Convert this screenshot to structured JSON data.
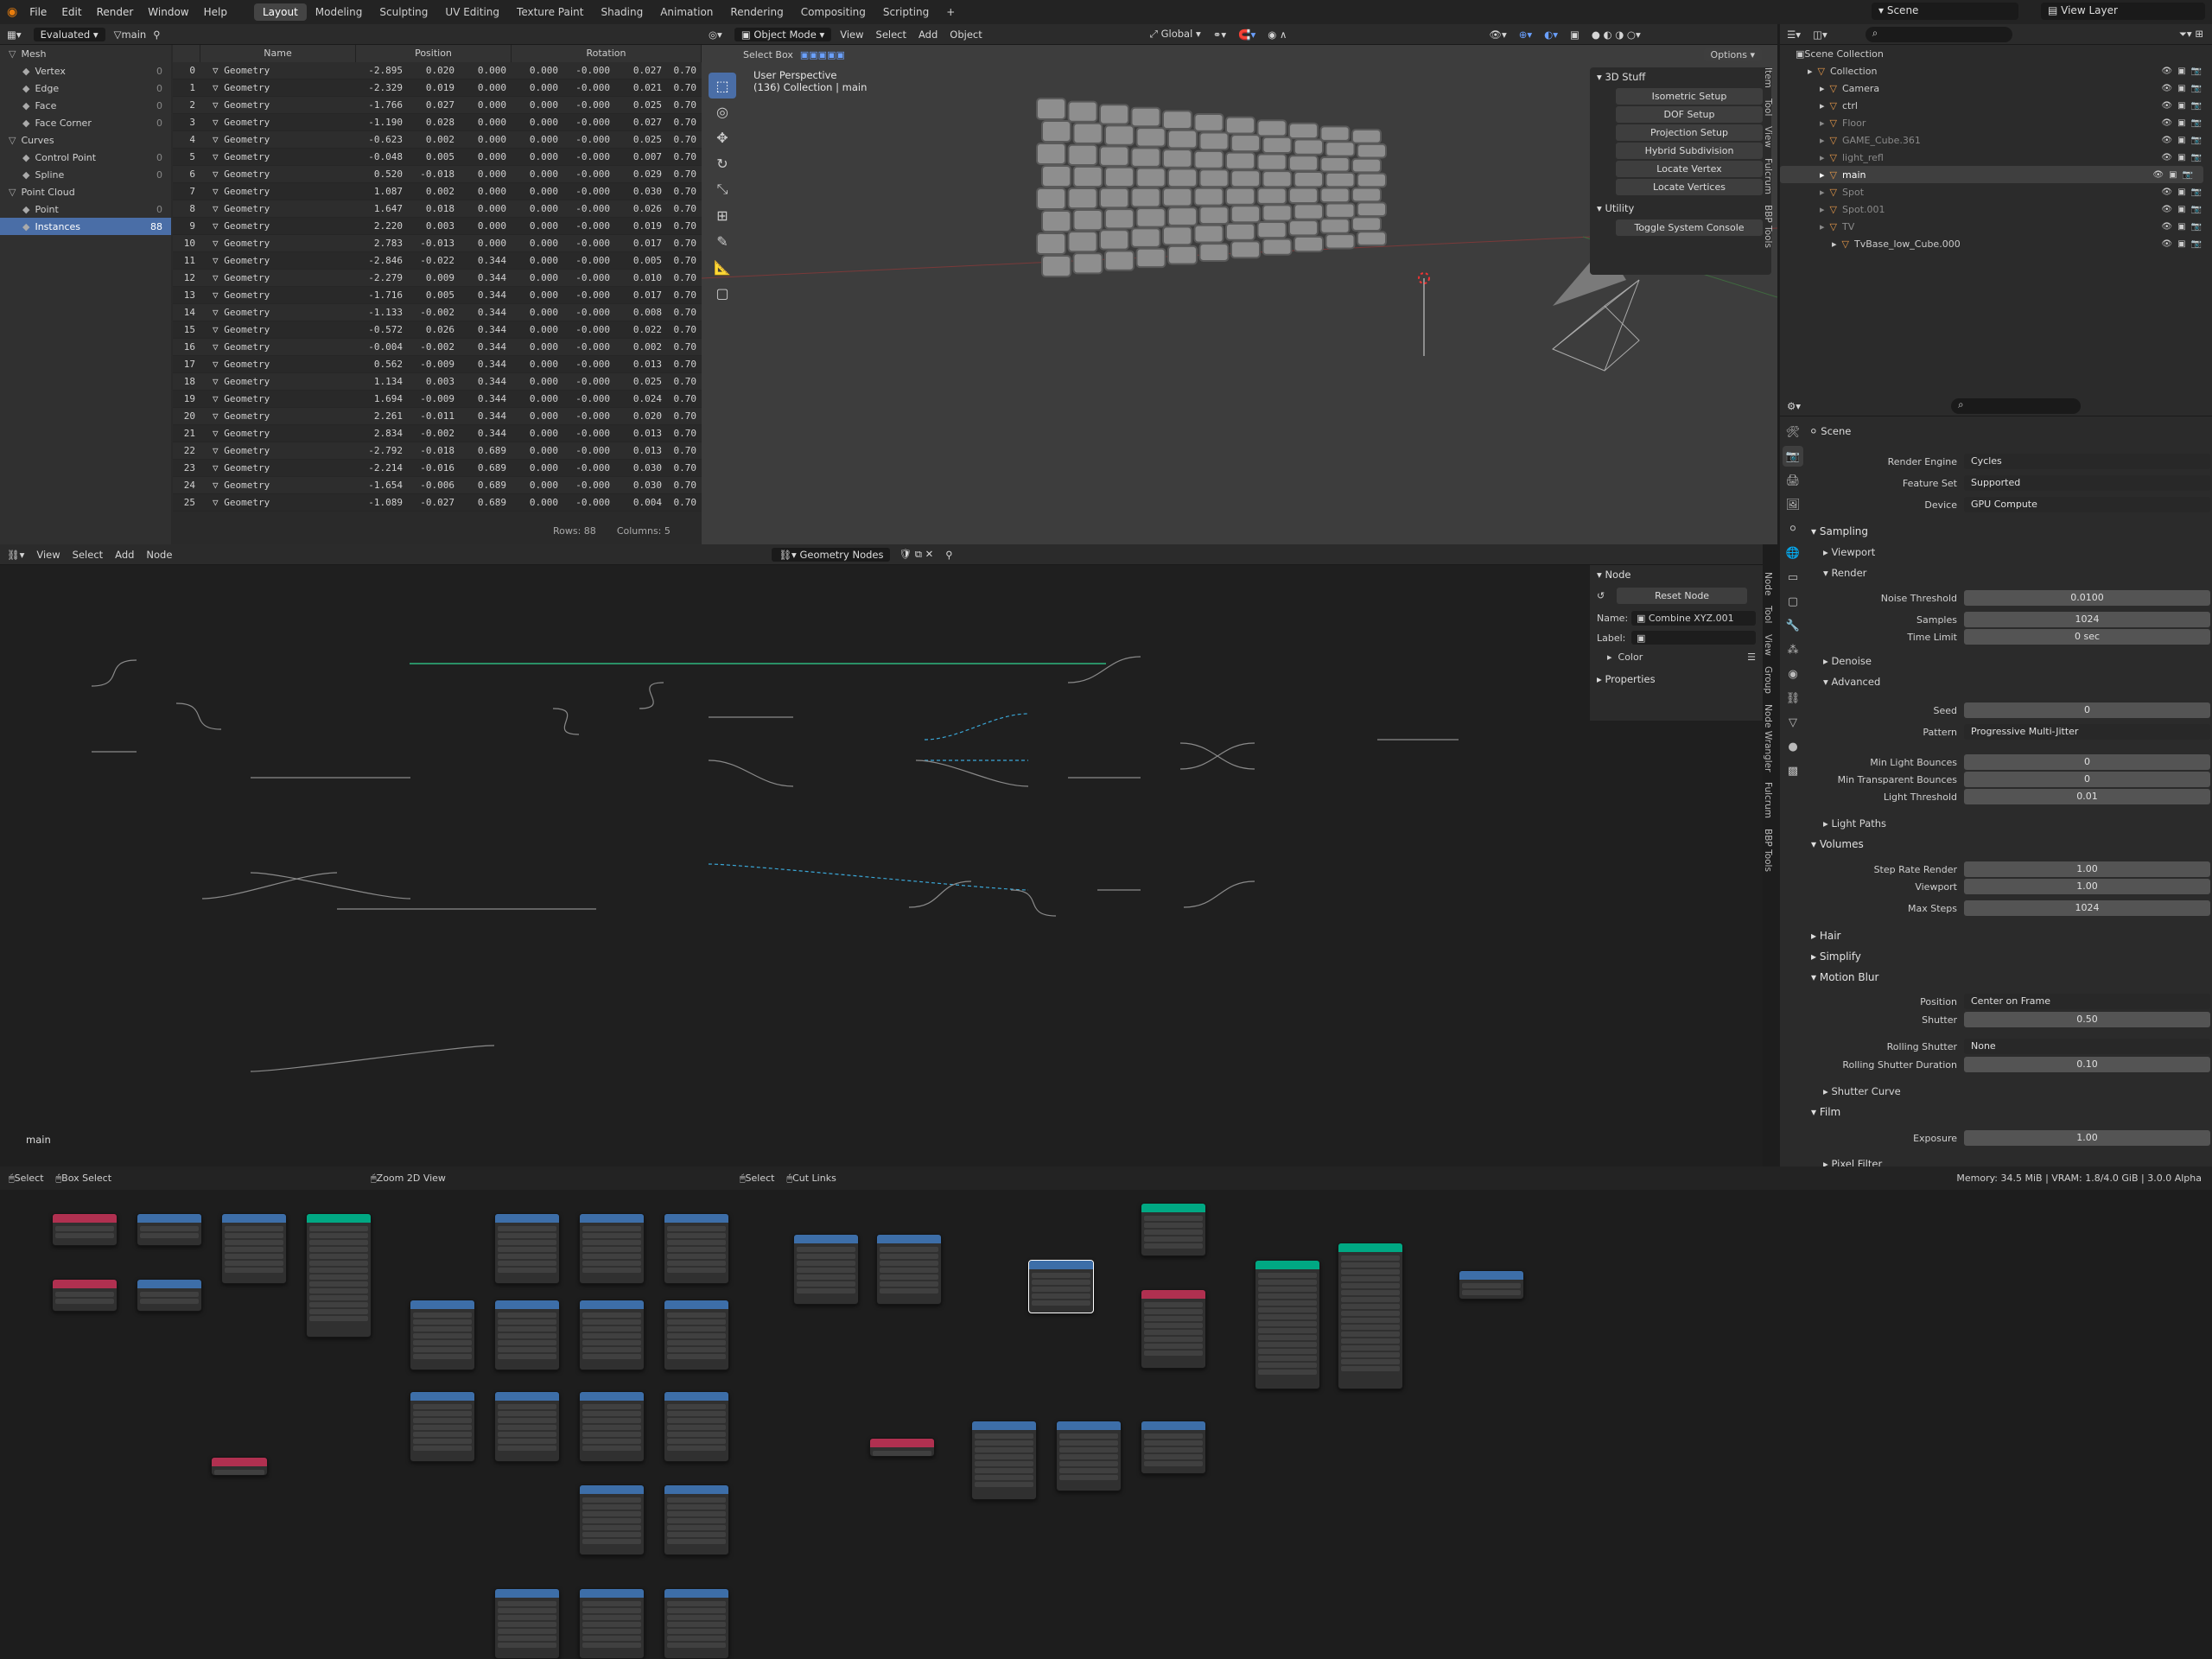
{
  "menu": [
    "File",
    "Edit",
    "Render",
    "Window",
    "Help"
  ],
  "workspaces": [
    "Layout",
    "Modeling",
    "Sculpting",
    "UV Editing",
    "Texture Paint",
    "Shading",
    "Animation",
    "Rendering",
    "Compositing",
    "Scripting",
    "+"
  ],
  "scene": "Scene",
  "view_layer": "View Layer",
  "sheet": {
    "evaluated": "Evaluated",
    "object": "main",
    "tree": [
      {
        "label": "Mesh",
        "count": ""
      },
      {
        "label": "Vertex",
        "count": "0"
      },
      {
        "label": "Edge",
        "count": "0"
      },
      {
        "label": "Face",
        "count": "0"
      },
      {
        "label": "Face Corner",
        "count": "0"
      },
      {
        "label": "Curves",
        "count": ""
      },
      {
        "label": "Control Point",
        "count": "0"
      },
      {
        "label": "Spline",
        "count": "0"
      },
      {
        "label": "Point Cloud",
        "count": ""
      },
      {
        "label": "Point",
        "count": "0"
      },
      {
        "label": "Instances",
        "count": "88"
      }
    ],
    "columns": [
      "Name",
      "Position",
      "Rotation"
    ],
    "rows": [
      [
        "0",
        "Geometry",
        "-2.895",
        "0.020",
        "0.000",
        "0.000",
        "-0.000",
        "0.027",
        "0.70"
      ],
      [
        "1",
        "Geometry",
        "-2.329",
        "0.019",
        "0.000",
        "0.000",
        "-0.000",
        "0.021",
        "0.70"
      ],
      [
        "2",
        "Geometry",
        "-1.766",
        "0.027",
        "0.000",
        "0.000",
        "-0.000",
        "0.025",
        "0.70"
      ],
      [
        "3",
        "Geometry",
        "-1.190",
        "0.028",
        "0.000",
        "0.000",
        "-0.000",
        "0.027",
        "0.70"
      ],
      [
        "4",
        "Geometry",
        "-0.623",
        "0.002",
        "0.000",
        "0.000",
        "-0.000",
        "0.025",
        "0.70"
      ],
      [
        "5",
        "Geometry",
        "-0.048",
        "0.005",
        "0.000",
        "0.000",
        "-0.000",
        "0.007",
        "0.70"
      ],
      [
        "6",
        "Geometry",
        "0.520",
        "-0.018",
        "0.000",
        "0.000",
        "-0.000",
        "0.029",
        "0.70"
      ],
      [
        "7",
        "Geometry",
        "1.087",
        "0.002",
        "0.000",
        "0.000",
        "-0.000",
        "0.030",
        "0.70"
      ],
      [
        "8",
        "Geometry",
        "1.647",
        "0.018",
        "0.000",
        "0.000",
        "-0.000",
        "0.026",
        "0.70"
      ],
      [
        "9",
        "Geometry",
        "2.220",
        "0.003",
        "0.000",
        "0.000",
        "-0.000",
        "0.019",
        "0.70"
      ],
      [
        "10",
        "Geometry",
        "2.783",
        "-0.013",
        "0.000",
        "0.000",
        "-0.000",
        "0.017",
        "0.70"
      ],
      [
        "11",
        "Geometry",
        "-2.846",
        "-0.022",
        "0.344",
        "0.000",
        "-0.000",
        "0.005",
        "0.70"
      ],
      [
        "12",
        "Geometry",
        "-2.279",
        "0.009",
        "0.344",
        "0.000",
        "-0.000",
        "0.010",
        "0.70"
      ],
      [
        "13",
        "Geometry",
        "-1.716",
        "0.005",
        "0.344",
        "0.000",
        "-0.000",
        "0.017",
        "0.70"
      ],
      [
        "14",
        "Geometry",
        "-1.133",
        "-0.002",
        "0.344",
        "0.000",
        "-0.000",
        "0.008",
        "0.70"
      ],
      [
        "15",
        "Geometry",
        "-0.572",
        "0.026",
        "0.344",
        "0.000",
        "-0.000",
        "0.022",
        "0.70"
      ],
      [
        "16",
        "Geometry",
        "-0.004",
        "-0.002",
        "0.344",
        "0.000",
        "-0.000",
        "0.002",
        "0.70"
      ],
      [
        "17",
        "Geometry",
        "0.562",
        "-0.009",
        "0.344",
        "0.000",
        "-0.000",
        "0.013",
        "0.70"
      ],
      [
        "18",
        "Geometry",
        "1.134",
        "0.003",
        "0.344",
        "0.000",
        "-0.000",
        "0.025",
        "0.70"
      ],
      [
        "19",
        "Geometry",
        "1.694",
        "-0.009",
        "0.344",
        "0.000",
        "-0.000",
        "0.024",
        "0.70"
      ],
      [
        "20",
        "Geometry",
        "2.261",
        "-0.011",
        "0.344",
        "0.000",
        "-0.000",
        "0.020",
        "0.70"
      ],
      [
        "21",
        "Geometry",
        "2.834",
        "-0.002",
        "0.344",
        "0.000",
        "-0.000",
        "0.013",
        "0.70"
      ],
      [
        "22",
        "Geometry",
        "-2.792",
        "-0.018",
        "0.689",
        "0.000",
        "-0.000",
        "0.013",
        "0.70"
      ],
      [
        "23",
        "Geometry",
        "-2.214",
        "-0.016",
        "0.689",
        "0.000",
        "-0.000",
        "0.030",
        "0.70"
      ],
      [
        "24",
        "Geometry",
        "-1.654",
        "-0.006",
        "0.689",
        "0.000",
        "-0.000",
        "0.030",
        "0.70"
      ],
      [
        "25",
        "Geometry",
        "-1.089",
        "-0.027",
        "0.689",
        "0.000",
        "-0.000",
        "0.004",
        "0.70"
      ]
    ],
    "footer_rows": "Rows: 88",
    "footer_cols": "Columns: 5"
  },
  "viewport": {
    "mode": "Object Mode",
    "menus": [
      "View",
      "Select",
      "Add",
      "Object"
    ],
    "select_box": "Select Box",
    "orientation": "Global",
    "options": "Options",
    "title": "User Perspective",
    "subtitle": "(136) Collection | main"
  },
  "npanel": {
    "section1": "3D Stuff",
    "buttons": [
      "Isometric Setup",
      "DOF Setup",
      "Projection Setup",
      "Hybrid Subdivision",
      "Locate Vertex",
      "Locate Vertices"
    ],
    "section2": "Utility",
    "utility_btn": "Toggle System Console",
    "tabs": [
      "Item",
      "Tool",
      "View",
      "Fulcrum",
      "BBP Tools"
    ]
  },
  "outliner": {
    "title": "Scene Collection",
    "items": [
      {
        "label": "Collection",
        "indent": 1,
        "cls": ""
      },
      {
        "label": "Camera",
        "indent": 2,
        "cls": ""
      },
      {
        "label": "ctrl",
        "indent": 2,
        "cls": ""
      },
      {
        "label": "Floor",
        "indent": 2,
        "cls": "dim"
      },
      {
        "label": "GAME_Cube.361",
        "indent": 2,
        "cls": "dim"
      },
      {
        "label": "light_refl",
        "indent": 2,
        "cls": "dim"
      },
      {
        "label": "main",
        "indent": 2,
        "cls": "sel"
      },
      {
        "label": "Spot",
        "indent": 2,
        "cls": "dim"
      },
      {
        "label": "Spot.001",
        "indent": 2,
        "cls": "dim"
      },
      {
        "label": "TV",
        "indent": 2,
        "cls": "dim"
      },
      {
        "label": "TvBase_low_Cube.000",
        "indent": 3,
        "cls": ""
      }
    ]
  },
  "props": {
    "scene": "Scene",
    "render_engine_label": "Render Engine",
    "render_engine": "Cycles",
    "feature_set_label": "Feature Set",
    "feature_set": "Supported",
    "device_label": "Device",
    "device": "GPU Compute",
    "sampling": "Sampling",
    "viewport": "Viewport",
    "render": "Render",
    "noise_threshold_label": "Noise Threshold",
    "noise_threshold": "0.0100",
    "samples_label": "Samples",
    "samples": "1024",
    "time_limit_label": "Time Limit",
    "time_limit": "0 sec",
    "denoise": "Denoise",
    "advanced": "Advanced",
    "seed_label": "Seed",
    "seed": "0",
    "pattern_label": "Pattern",
    "pattern": "Progressive Multi-Jitter",
    "min_light_label": "Min Light Bounces",
    "min_light": "0",
    "min_trans_label": "Min Transparent Bounces",
    "min_trans": "0",
    "light_thresh_label": "Light Threshold",
    "light_thresh": "0.01",
    "light_paths": "Light Paths",
    "volumes": "Volumes",
    "step_rate_label": "Step Rate Render",
    "step_rate": "1.00",
    "vol_viewport_label": "Viewport",
    "vol_viewport": "1.00",
    "max_steps_label": "Max Steps",
    "max_steps": "1024",
    "hair": "Hair",
    "simplify": "Simplify",
    "motion_blur": "Motion Blur",
    "position_label": "Position",
    "position": "Center on Frame",
    "shutter_label": "Shutter",
    "shutter": "0.50",
    "rolling_label": "Rolling Shutter",
    "rolling": "None",
    "rolling_dur_label": "Rolling Shutter Duration",
    "rolling_dur": "0.10",
    "shutter_curve": "Shutter Curve",
    "film": "Film",
    "exposure_label": "Exposure",
    "exposure": "1.00",
    "pixel_filter": "Pixel Filter"
  },
  "node_editor": {
    "menus": [
      "View",
      "Select",
      "Add",
      "Node"
    ],
    "tree": "Geometry Nodes",
    "frame_label": "main"
  },
  "node_panel": {
    "section": "Node",
    "reset": "Reset Node",
    "name_label": "Name:",
    "name": "Combine XYZ.001",
    "label_label": "Label:",
    "color": "Color",
    "properties": "Properties",
    "tabs": [
      "Node",
      "Tool",
      "View",
      "Group",
      "Node Wrangler",
      "Fulcrum",
      "BBP Tools"
    ]
  },
  "status": {
    "select": "Select",
    "box_select": "Box Select",
    "zoom": "Zoom 2D View",
    "select2": "Select",
    "cut_links": "Cut Links",
    "memory": "Memory: 34.5 MiB | VRAM: 1.8/4.0 GiB | 3.0.0 Alpha"
  },
  "colors": {
    "accent": "#4a6ea7",
    "geometry_node": "#00a883",
    "input_node": "#b03050",
    "math_node": "#3d6ea8"
  }
}
